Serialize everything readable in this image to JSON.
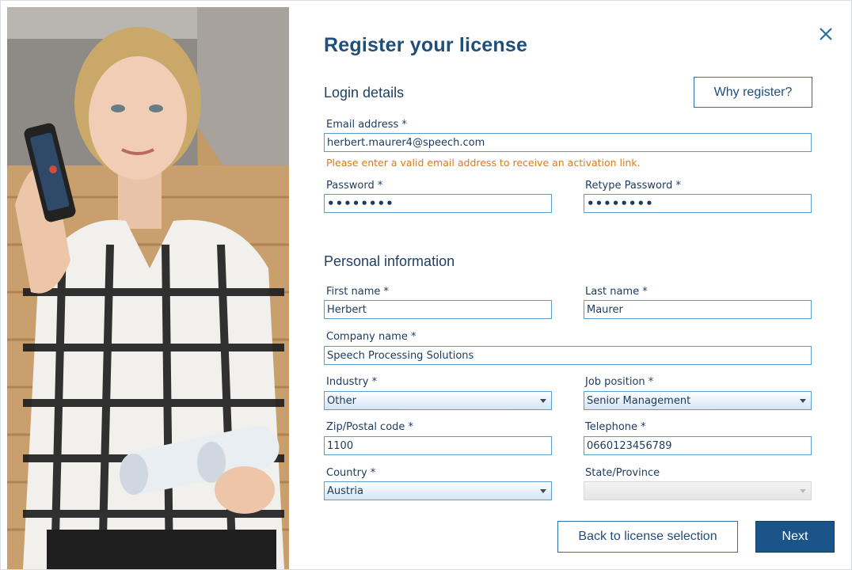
{
  "title": "Register your license",
  "close_icon": "close-icon",
  "login": {
    "heading": "Login details",
    "why_register": "Why register?",
    "email_label": "Email address *",
    "email_value": "herbert.maurer4@speech.com",
    "email_hint": "Please enter a valid email address to receive an activation link.",
    "password_label": "Password *",
    "password_mask": "••••••••",
    "retype_label": "Retype Password *",
    "retype_mask": "••••••••"
  },
  "personal": {
    "heading": "Personal information",
    "first_name_label": "First name *",
    "first_name_value": "Herbert",
    "last_name_label": "Last name *",
    "last_name_value": "Maurer",
    "company_label": "Company name *",
    "company_value": "Speech Processing Solutions",
    "industry_label": "Industry *",
    "industry_value": "Other",
    "job_label": "Job position *",
    "job_value": "Senior Management",
    "zip_label": "Zip/Postal code *",
    "zip_value": "1100",
    "phone_label": "Telephone *",
    "phone_value": "0660123456789",
    "country_label": "Country *",
    "country_value": "Austria",
    "state_label": "State/Province",
    "state_value": ""
  },
  "footer": {
    "back_label": "Back to license selection",
    "next_label": "Next"
  },
  "colors": {
    "title": "#1f4e79",
    "accent": "#1b5488",
    "field_border": "#5a9ccc",
    "hint": "#e07a10"
  }
}
